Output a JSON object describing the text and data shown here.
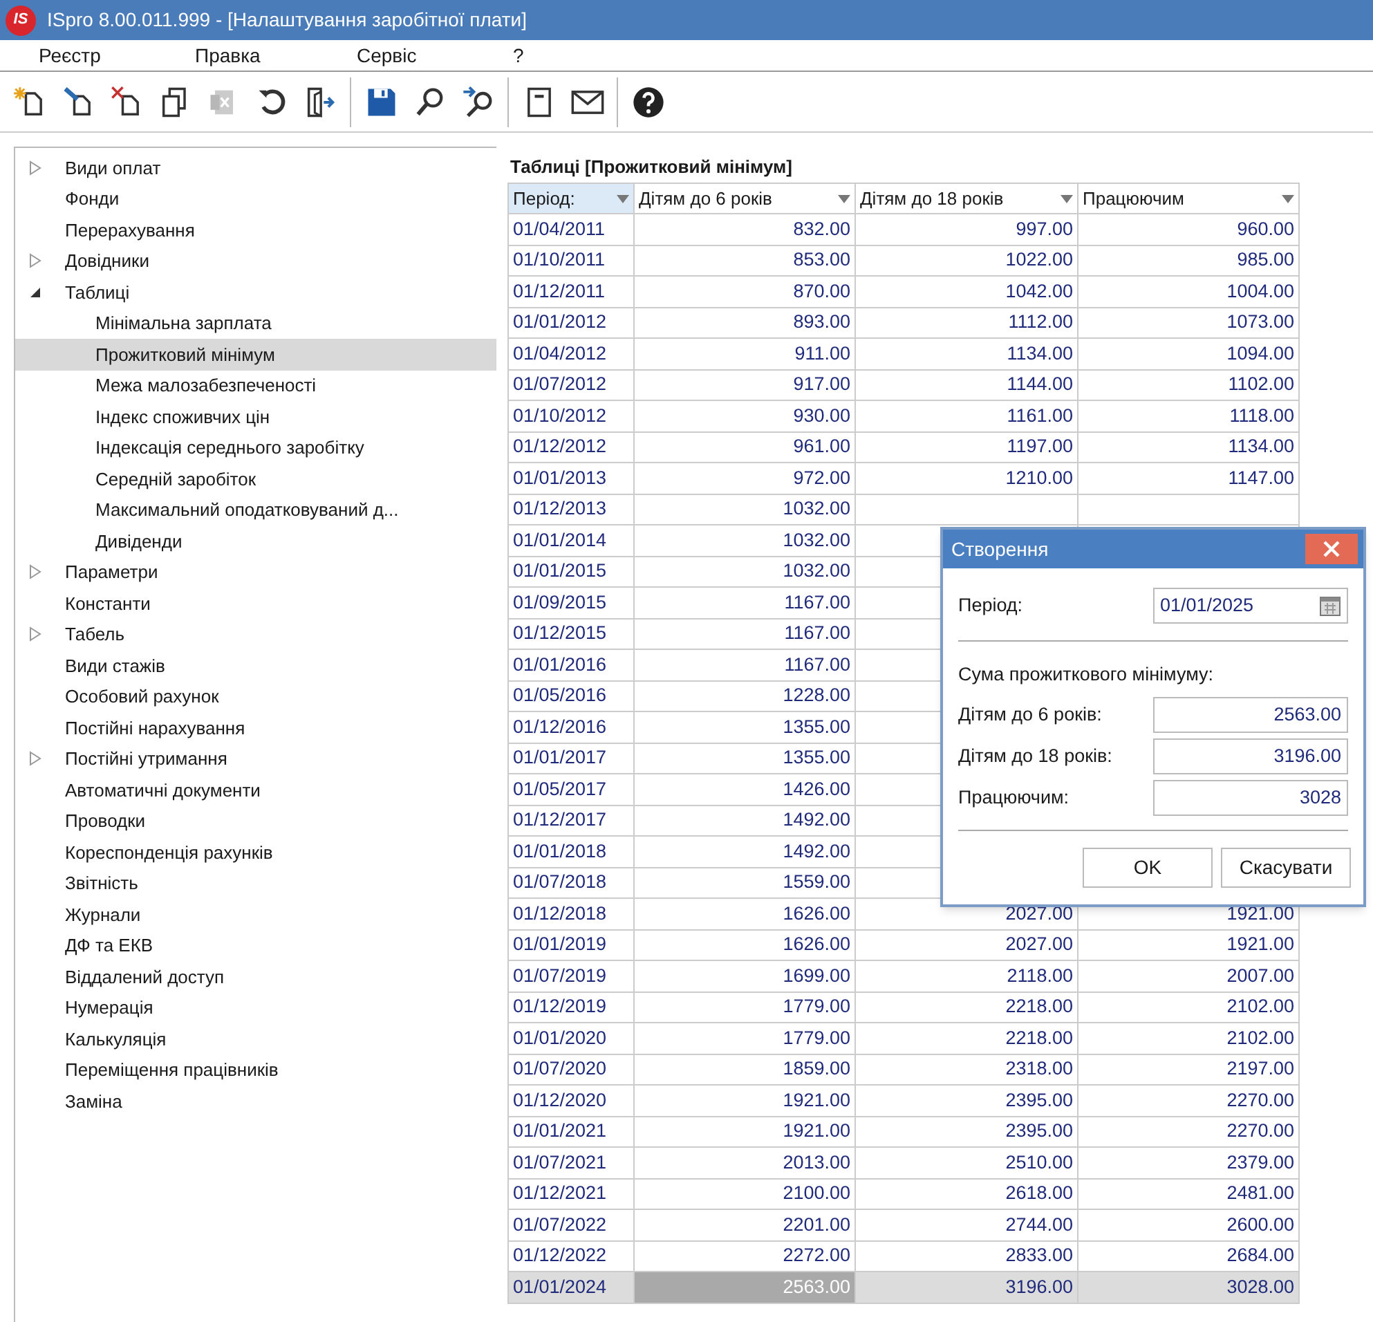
{
  "window": {
    "logo": "IS",
    "title": "ISpro 8.00.011.999 - [Налаштування заробітної плати]"
  },
  "menu": [
    "Реєстр",
    "Правка",
    "Сервіс",
    "?"
  ],
  "toolbar_groups": [
    [
      {
        "disabled": false
      },
      {
        "disabled": false
      },
      {
        "disabled": false
      },
      {
        "disabled": false
      },
      {
        "disabled": true
      },
      {
        "disabled": false
      },
      {
        "disabled": false
      }
    ],
    [
      {
        "disabled": false
      },
      {
        "disabled": false
      },
      {
        "disabled": false
      }
    ],
    [
      {
        "disabled": false
      },
      {
        "disabled": false
      }
    ],
    [
      {
        "disabled": false
      }
    ]
  ],
  "tree": [
    {
      "label": "Види оплат",
      "expanded": false,
      "selected": false
    },
    {
      "label": "Фонди",
      "selected": false
    },
    {
      "label": "Перерахування",
      "selected": false
    },
    {
      "label": "Довідники",
      "expanded": false,
      "selected": false
    },
    {
      "label": "Таблиці",
      "expanded": true,
      "selected": false,
      "children": [
        {
          "label": "Мінімальна зарплата",
          "selected": false
        },
        {
          "label": "Прожитковий мінімум",
          "selected": true
        },
        {
          "label": "Межа малозабезпеченості",
          "selected": false
        },
        {
          "label": "Індекс споживчих цін",
          "selected": false
        },
        {
          "label": "Індексація середнього заробітку",
          "selected": false
        },
        {
          "label": "Середній заробіток",
          "selected": false
        },
        {
          "label": "Максимальний оподатковуваний д...",
          "selected": false
        },
        {
          "label": "Дивіденди",
          "selected": false
        }
      ]
    },
    {
      "label": "Параметри",
      "expanded": false,
      "selected": false
    },
    {
      "label": "Константи",
      "selected": false
    },
    {
      "label": "Табель",
      "expanded": false,
      "selected": false
    },
    {
      "label": "Види стажів",
      "selected": false
    },
    {
      "label": "Особовий рахунок",
      "selected": false
    },
    {
      "label": "Постійні нарахування",
      "selected": false
    },
    {
      "label": "Постійні утримання",
      "expanded": false,
      "selected": false
    },
    {
      "label": "Автоматичні документи",
      "selected": false
    },
    {
      "label": "Проводки",
      "selected": false
    },
    {
      "label": "Кореспонденція рахунків",
      "selected": false
    },
    {
      "label": "Звітність",
      "selected": false
    },
    {
      "label": "Журнали",
      "selected": false
    },
    {
      "label": "ДФ та ЕКВ",
      "selected": false
    },
    {
      "label": "Віддалений доступ",
      "selected": false
    },
    {
      "label": "Нумерація",
      "selected": false
    },
    {
      "label": "Калькуляція",
      "selected": false
    },
    {
      "label": "Переміщення працівників",
      "selected": false
    },
    {
      "label": "Заміна",
      "selected": false
    }
  ],
  "table": {
    "title": "Таблиці [Прожитковий мінімум]",
    "columns": [
      {
        "label": "Період:",
        "sorted": true
      },
      {
        "label": "Дітям до 6 років",
        "sorted": false
      },
      {
        "label": "Дітям до 18 років",
        "sorted": false
      },
      {
        "label": "Працюючим",
        "sorted": false
      }
    ],
    "rows": [
      {
        "cells": [
          "01/04/2011",
          "832.00",
          "997.00",
          "960.00"
        ],
        "selected": false
      },
      {
        "cells": [
          "01/10/2011",
          "853.00",
          "1022.00",
          "985.00"
        ],
        "selected": false
      },
      {
        "cells": [
          "01/12/2011",
          "870.00",
          "1042.00",
          "1004.00"
        ],
        "selected": false
      },
      {
        "cells": [
          "01/01/2012",
          "893.00",
          "1112.00",
          "1073.00"
        ],
        "selected": false
      },
      {
        "cells": [
          "01/04/2012",
          "911.00",
          "1134.00",
          "1094.00"
        ],
        "selected": false
      },
      {
        "cells": [
          "01/07/2012",
          "917.00",
          "1144.00",
          "1102.00"
        ],
        "selected": false
      },
      {
        "cells": [
          "01/10/2012",
          "930.00",
          "1161.00",
          "1118.00"
        ],
        "selected": false
      },
      {
        "cells": [
          "01/12/2012",
          "961.00",
          "1197.00",
          "1134.00"
        ],
        "selected": false
      },
      {
        "cells": [
          "01/01/2013",
          "972.00",
          "1210.00",
          "1147.00"
        ],
        "selected": false
      },
      {
        "cells": [
          "01/12/2013",
          "1032.00"
        ],
        "selected": false
      },
      {
        "cells": [
          "01/01/2014",
          "1032.00"
        ],
        "selected": false
      },
      {
        "cells": [
          "01/01/2015",
          "1032.00"
        ],
        "selected": false
      },
      {
        "cells": [
          "01/09/2015",
          "1167.00"
        ],
        "selected": false
      },
      {
        "cells": [
          "01/12/2015",
          "1167.00"
        ],
        "selected": false
      },
      {
        "cells": [
          "01/01/2016",
          "1167.00"
        ],
        "selected": false
      },
      {
        "cells": [
          "01/05/2016",
          "1228.00"
        ],
        "selected": false
      },
      {
        "cells": [
          "01/12/2016",
          "1355.00"
        ],
        "selected": false
      },
      {
        "cells": [
          "01/01/2017",
          "1355.00"
        ],
        "selected": false
      },
      {
        "cells": [
          "01/05/2017",
          "1426.00"
        ],
        "selected": false
      },
      {
        "cells": [
          "01/12/2017",
          "1492.00"
        ],
        "selected": false
      },
      {
        "cells": [
          "01/01/2018",
          "1492.00"
        ],
        "selected": false
      },
      {
        "cells": [
          "01/07/2018",
          "1559.00"
        ],
        "selected": false
      },
      {
        "cells": [
          "01/12/2018",
          "1626.00",
          "2027.00",
          "1921.00"
        ],
        "selected": false
      },
      {
        "cells": [
          "01/01/2019",
          "1626.00",
          "2027.00",
          "1921.00"
        ],
        "selected": false
      },
      {
        "cells": [
          "01/07/2019",
          "1699.00",
          "2118.00",
          "2007.00"
        ],
        "selected": false
      },
      {
        "cells": [
          "01/12/2019",
          "1779.00",
          "2218.00",
          "2102.00"
        ],
        "selected": false
      },
      {
        "cells": [
          "01/01/2020",
          "1779.00",
          "2218.00",
          "2102.00"
        ],
        "selected": false
      },
      {
        "cells": [
          "01/07/2020",
          "1859.00",
          "2318.00",
          "2197.00"
        ],
        "selected": false
      },
      {
        "cells": [
          "01/12/2020",
          "1921.00",
          "2395.00",
          "2270.00"
        ],
        "selected": false
      },
      {
        "cells": [
          "01/01/2021",
          "1921.00",
          "2395.00",
          "2270.00"
        ],
        "selected": false
      },
      {
        "cells": [
          "01/07/2021",
          "2013.00",
          "2510.00",
          "2379.00"
        ],
        "selected": false
      },
      {
        "cells": [
          "01/12/2021",
          "2100.00",
          "2618.00",
          "2481.00"
        ],
        "selected": false
      },
      {
        "cells": [
          "01/07/2022",
          "2201.00",
          "2744.00",
          "2600.00"
        ],
        "selected": false
      },
      {
        "cells": [
          "01/12/2022",
          "2272.00",
          "2833.00",
          "2684.00"
        ],
        "selected": false
      },
      {
        "cells": [
          "01/01/2024",
          "2563.00",
          "3196.00",
          "3028.00"
        ],
        "selected": true
      }
    ]
  },
  "dialog": {
    "title": "Створення",
    "period": {
      "label": "Період:",
      "value": "01/01/2025"
    },
    "section": "Сума прожиткового мінімуму:",
    "fields": [
      {
        "label": "Дітям до 6 років:",
        "value": "2563.00"
      },
      {
        "label": "Дітям до 18 років:",
        "value": "3196.00"
      },
      {
        "label": "Працюючим:",
        "value": "3028"
      }
    ],
    "buttons": [
      "OK",
      "Скасувати"
    ]
  }
}
